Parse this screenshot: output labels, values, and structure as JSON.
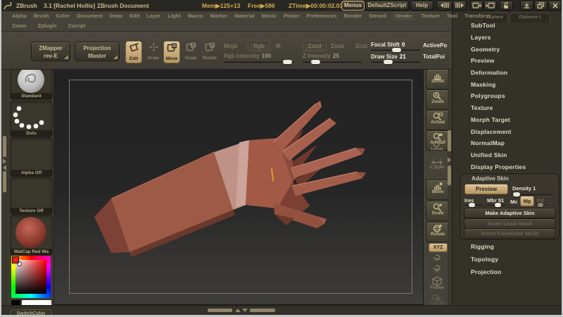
{
  "title_bar": {
    "app": "ZBrush",
    "version": "3.1",
    "user": "[Rachel Hollis]",
    "doc": "ZBrush Document",
    "mem": "Mem▶125+13",
    "free": "Free▶586",
    "ztime": "ZTime▶00:00:02.03",
    "menus": "Menus",
    "zscript": "DefaultZScript",
    "help": "Help"
  },
  "menus": {
    "row1": [
      "Alpha",
      "Brush",
      "Color",
      "Document",
      "Draw",
      "Edit",
      "Layer",
      "Light",
      "Macro",
      "Marker",
      "Material",
      "Movie",
      "Picker",
      "Preferences",
      "Render",
      "Stencil",
      "Stroke",
      "Texture",
      "Tool",
      "Transform"
    ],
    "row2": [
      "Zoom",
      "Zplugin",
      "Zscript"
    ]
  },
  "shelf": {
    "zmapper1": "ZMapper",
    "zmapper2": "rev-E",
    "pm1": "Projection",
    "pm2": "Master",
    "edit": "Edit",
    "draw": "Draw",
    "move": "Move",
    "scale": "Scale",
    "rotate": "Rotate",
    "move_icon": "M",
    "scale_icon": "S",
    "rotate_icon": "R",
    "mrgb": "Mrgb",
    "rgb": "Rgb",
    "m": "M",
    "rgb_intensity": "Rgb Intensity",
    "rgb_intensity_value": "100",
    "zadd": "Zadd",
    "zsub": "Zsub",
    "zcut": "Zcut",
    "z_intensity": "Z Intensity",
    "z_intensity_value": "25",
    "focal_shift": "Focal Shift",
    "focal_shift_value": "0",
    "draw_size": "Draw Size",
    "draw_size_value": "21",
    "active_points": "ActivePo",
    "total_points": "TotalPoi"
  },
  "left_tray": {
    "brush": "Standard",
    "stroke": "Dots",
    "alpha": "Alpha Off",
    "texture": "Texture Off",
    "material": "MatCap Red Wa",
    "switch_color": "SwitchColor"
  },
  "right_shelf": {
    "scroll": "Scroll",
    "zoom": "Zoom",
    "actual": "Actual",
    "aahalf": "AAHalf",
    "local": "Local",
    "lsym": "L.Sym",
    "move": "Move",
    "scale": "Scale",
    "rotate": "Rotate",
    "xyz": "XYZ",
    "yrot": "Y",
    "zrot": "Z",
    "frame": "Frame",
    "transp": "Transp"
  },
  "right_tray": {
    "tab1": "ZSphere",
    "tab2": "ZSphere# 1",
    "sections": [
      "SubTool",
      "Layers",
      "Geometry",
      "Preview",
      "Deformation",
      "Masking",
      "Polygroups",
      "Texture",
      "Morph Target",
      "Displacement",
      "NormalMap",
      "Unified Skin",
      "Display Properties"
    ],
    "adaptive": {
      "title": "Adaptive Skin",
      "preview": "Preview",
      "density": "Density 1",
      "ires": "Ires",
      "mbr": "Mbr 51",
      "mc": "Mc",
      "mp": "Mp",
      "pd": "Pd",
      "make": "Make Adaptive Skin",
      "insert_local": "Insert Local Mesh",
      "insert_connector": "Insert Connector Mesh"
    },
    "sections_below": [
      "Rigging",
      "Topology",
      "Projection"
    ]
  },
  "colors": {
    "accent_tan": "#c8a671",
    "gold_text": "#d2aa50",
    "bright_text": "#ece8da",
    "dim_text": "#7d755f",
    "model_red": "#9d5a47",
    "wrist_band": "#bf9288",
    "marker_orange": "#e6992e",
    "canvas_top": "#222222",
    "canvas_bottom": "#3e3d3b"
  }
}
